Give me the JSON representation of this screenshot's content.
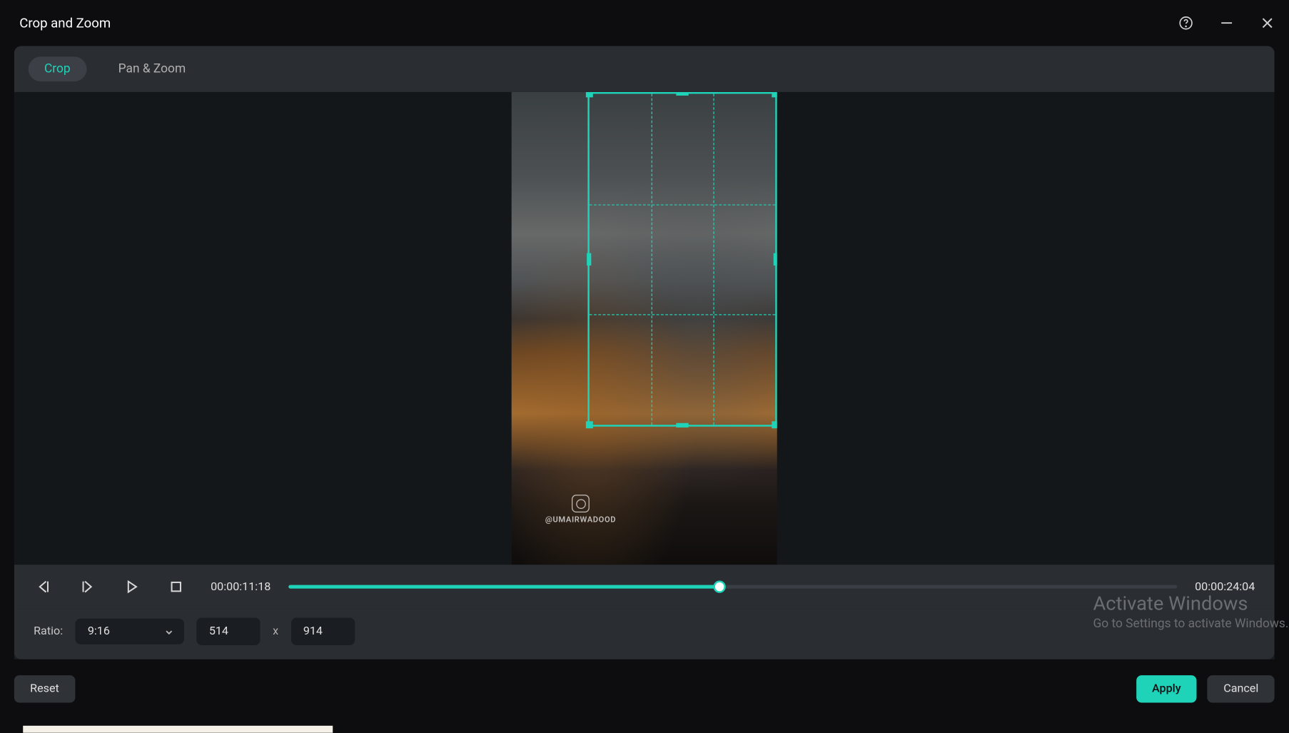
{
  "title": "Crop and Zoom",
  "tabs": {
    "crop": "Crop",
    "panzoom": "Pan & Zoom"
  },
  "watermark": "@UMAIRWADOOD",
  "playback": {
    "current_time": "00:00:11:18",
    "duration": "00:00:24:04",
    "progress_percent": 48.5
  },
  "settings": {
    "ratio_label": "Ratio:",
    "ratio_value": "9:16",
    "width": "514",
    "height": "914",
    "separator": "x"
  },
  "buttons": {
    "reset": "Reset",
    "apply": "Apply",
    "cancel": "Cancel"
  },
  "windows_watermark": {
    "title": "Activate Windows",
    "subtitle": "Go to Settings to activate Windows."
  },
  "colors": {
    "accent": "#1fd3b8",
    "bg_dark": "#0d0d0f",
    "bg_panel": "#2a2d32",
    "bg_preview": "#14171a"
  }
}
